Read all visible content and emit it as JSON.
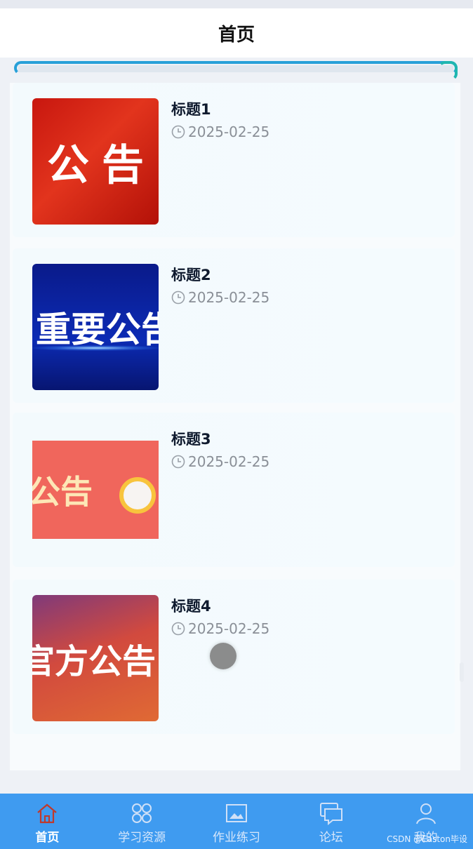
{
  "header": {
    "title": "首页"
  },
  "progress": {
    "value": 1.0
  },
  "list": {
    "items": [
      {
        "title": "标题1",
        "date": "2025-02-25",
        "thumb_text": "公告"
      },
      {
        "title": "标题2",
        "date": "2025-02-25",
        "thumb_text": "重要公告"
      },
      {
        "title": "标题3",
        "date": "2025-02-25",
        "thumb_text": "公告"
      },
      {
        "title": "标题4",
        "date": "2025-02-25",
        "thumb_text": "官方公告"
      }
    ]
  },
  "tabbar": {
    "tabs": [
      {
        "label": "首页",
        "icon": "home-icon",
        "active": true
      },
      {
        "label": "学习资源",
        "icon": "grid-icon",
        "active": false
      },
      {
        "label": "作业练习",
        "icon": "image-icon",
        "active": false
      },
      {
        "label": "论坛",
        "icon": "chat-icon",
        "active": false
      },
      {
        "label": "我的",
        "icon": "user-icon",
        "active": false
      }
    ]
  },
  "watermark": "CSDN @Easton毕设",
  "colors": {
    "tabbar_bg": "#3f9bf0",
    "progress_start": "#27a0d8",
    "progress_end": "#1fb6b0",
    "date_text": "#8a8f97"
  }
}
